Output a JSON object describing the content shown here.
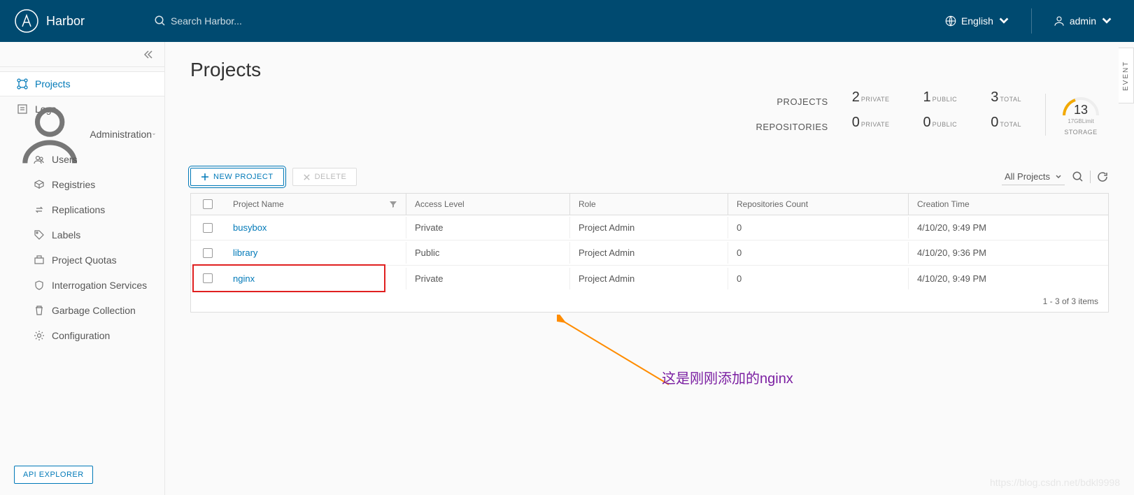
{
  "header": {
    "title": "Harbor",
    "search_placeholder": "Search Harbor...",
    "language": "English",
    "user": "admin"
  },
  "sidebar": {
    "items": [
      {
        "label": "Projects",
        "active": true
      },
      {
        "label": "Logs"
      },
      {
        "label": "Administration",
        "group": true
      },
      {
        "label": "Users",
        "sub": true
      },
      {
        "label": "Registries",
        "sub": true
      },
      {
        "label": "Replications",
        "sub": true
      },
      {
        "label": "Labels",
        "sub": true
      },
      {
        "label": "Project Quotas",
        "sub": true
      },
      {
        "label": "Interrogation Services",
        "sub": true
      },
      {
        "label": "Garbage Collection",
        "sub": true
      },
      {
        "label": "Configuration",
        "sub": true
      }
    ],
    "api_explorer": "API EXPLORER"
  },
  "page": {
    "title": "Projects",
    "event_tab": "EVENT"
  },
  "summary": {
    "projects_label": "PROJECTS",
    "repos_label": "REPOSITORIES",
    "projects": {
      "private_n": "2",
      "public_n": "1",
      "total_n": "3"
    },
    "repos": {
      "private_n": "0",
      "public_n": "0",
      "total_n": "0"
    },
    "labels": {
      "private": "PRIVATE",
      "public": "PUBLIC",
      "total": "TOTAL"
    },
    "storage": {
      "value": "13",
      "limit": "17GBLimit",
      "label": "STORAGE"
    }
  },
  "toolbar": {
    "new_project": "NEW PROJECT",
    "delete": "DELETE",
    "filter": "All Projects"
  },
  "table": {
    "columns": {
      "name": "Project Name",
      "access": "Access Level",
      "role": "Role",
      "repos": "Repositories Count",
      "time": "Creation Time"
    },
    "rows": [
      {
        "name": "busybox",
        "access": "Private",
        "role": "Project Admin",
        "repos": "0",
        "time": "4/10/20, 9:49 PM",
        "highlighted": false
      },
      {
        "name": "library",
        "access": "Public",
        "role": "Project Admin",
        "repos": "0",
        "time": "4/10/20, 9:36 PM",
        "highlighted": false
      },
      {
        "name": "nginx",
        "access": "Private",
        "role": "Project Admin",
        "repos": "0",
        "time": "4/10/20, 9:49 PM",
        "highlighted": true
      }
    ],
    "footer": "1 - 3 of 3 items"
  },
  "annotation": {
    "text": "这是刚刚添加的nginx"
  },
  "watermark": "https://blog.csdn.net/bdkl9998"
}
